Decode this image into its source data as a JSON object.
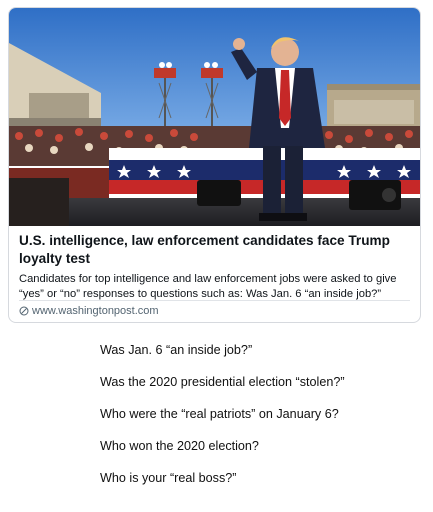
{
  "card": {
    "image_description_icon": "rally-photo",
    "title": "U.S. intelligence, law enforcement candidates face Trump loyalty test",
    "description": "Candidates for top intelligence and law enforcement jobs were asked to give “yes” or “no” responses to questions such as: Was Jan. 6 “an inside job?”",
    "source_icon": "link-icon",
    "source": "www.washingtonpost.com"
  },
  "questions": [
    "Was Jan. 6 “an inside job?”",
    "Was the 2020 presidential election “stolen?”",
    "Who were the “real patriots” on January 6?",
    "Who won the 2020 election?",
    "Who is your “real boss?”"
  ],
  "colors": {
    "sky": "#3d7fd4",
    "card_border": "#d6d9de",
    "source_text": "#536471"
  }
}
